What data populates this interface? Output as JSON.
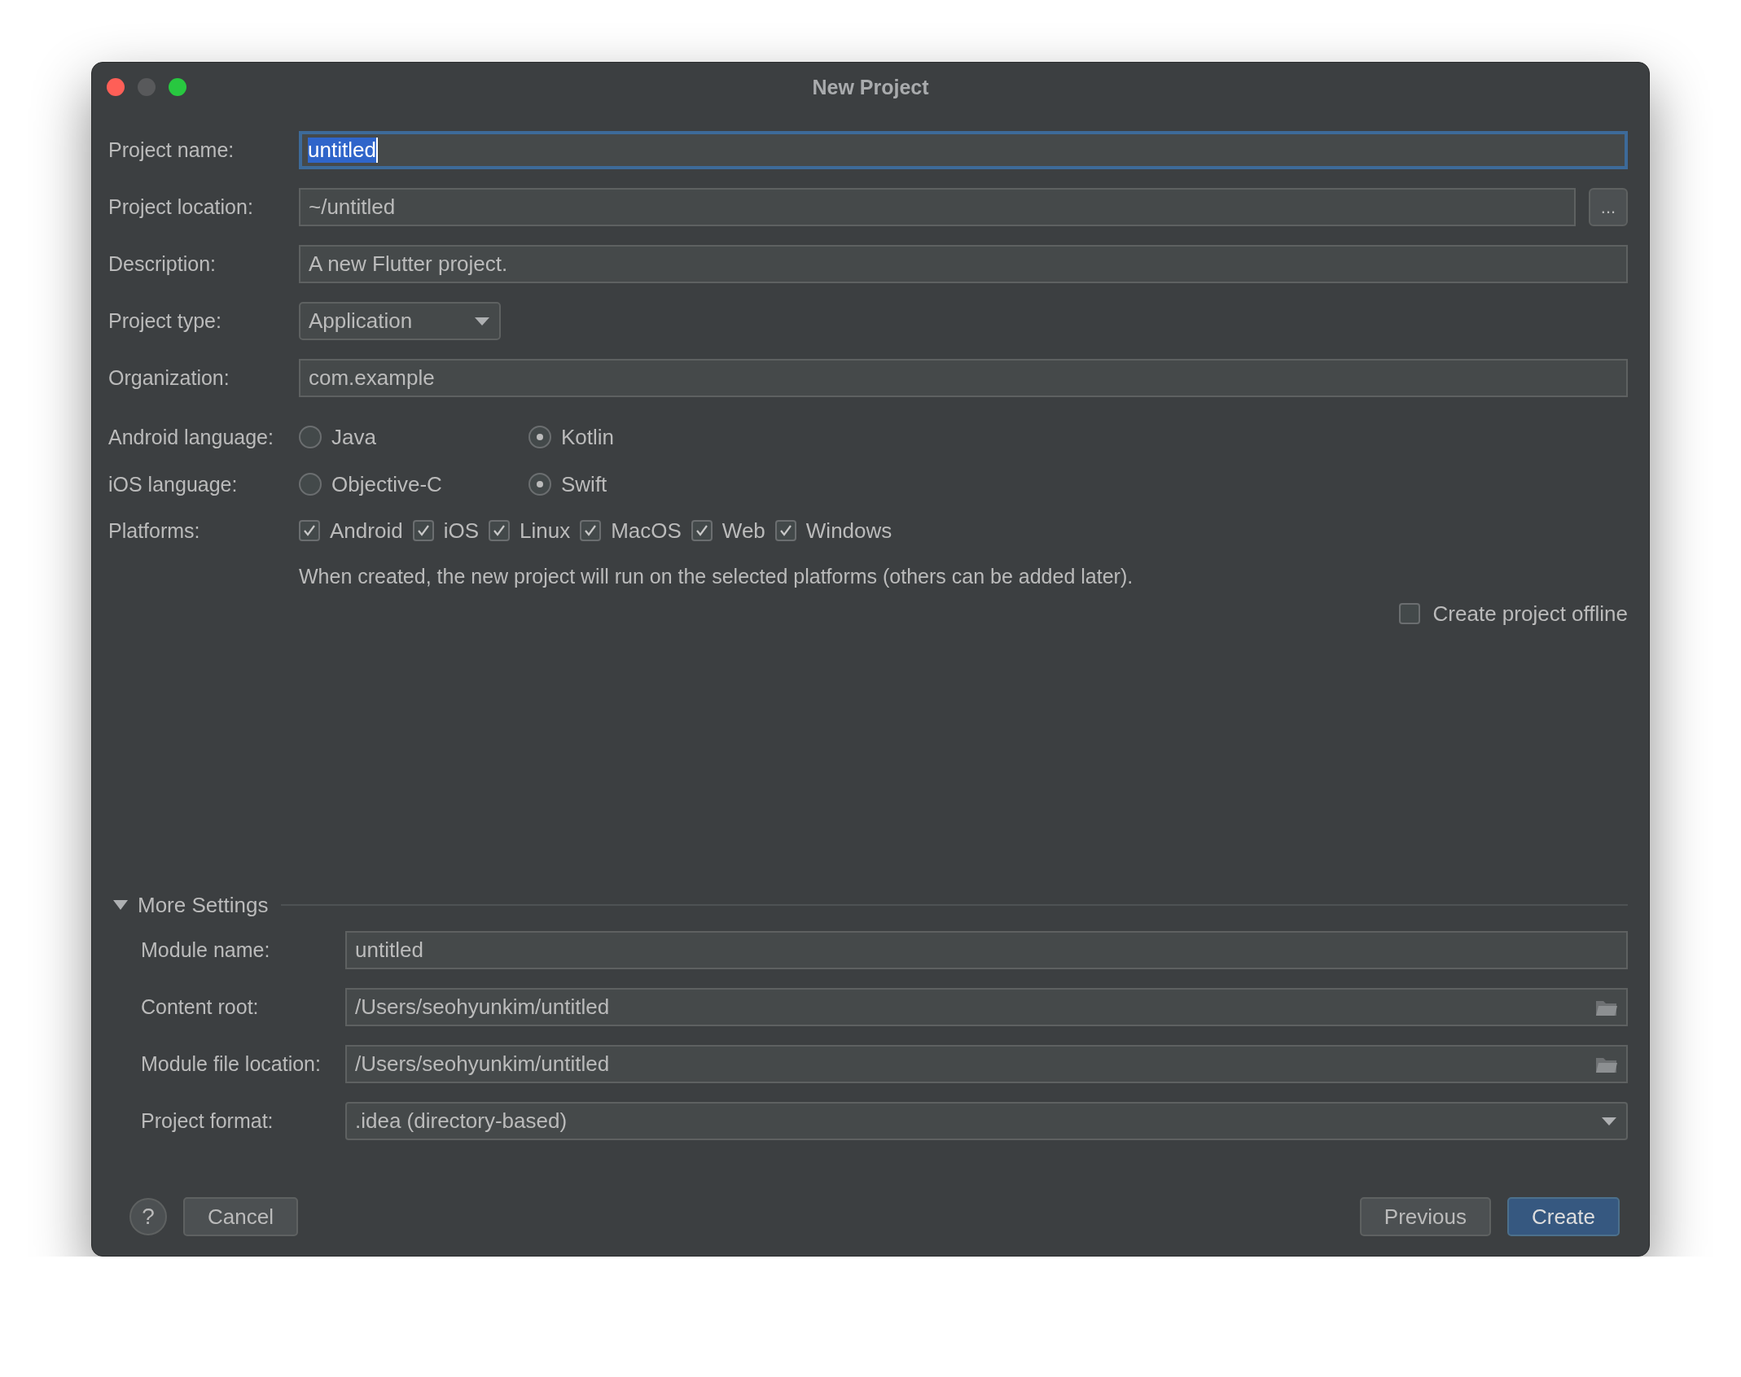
{
  "window": {
    "title": "New Project"
  },
  "fields": [
    {
      "label": "Project name:",
      "kind": "text",
      "value": "untitled",
      "focused": true
    },
    {
      "label": "Project location:",
      "kind": "browse",
      "value": "~/untitled",
      "button": "..."
    },
    {
      "label": "Description:",
      "kind": "text",
      "value": "A new Flutter project."
    },
    {
      "label": "Project type:",
      "kind": "dropdown",
      "value": "Application"
    },
    {
      "label": "Organization:",
      "kind": "text",
      "value": "com.example"
    }
  ],
  "android_language": {
    "label": "Android language:",
    "options": [
      {
        "label": "Java",
        "selected": false
      },
      {
        "label": "Kotlin",
        "selected": true
      }
    ]
  },
  "ios_language": {
    "label": "iOS language:",
    "options": [
      {
        "label": "Objective-C",
        "selected": false
      },
      {
        "label": "Swift",
        "selected": true
      }
    ]
  },
  "platforms": {
    "label": "Platforms:",
    "options": [
      {
        "label": "Android",
        "checked": true
      },
      {
        "label": "iOS",
        "checked": true
      },
      {
        "label": "Linux",
        "checked": true
      },
      {
        "label": "MacOS",
        "checked": true
      },
      {
        "label": "Web",
        "checked": true
      },
      {
        "label": "Windows",
        "checked": true
      }
    ],
    "note": "When created, the new project will run on the selected platforms (others can be added later)."
  },
  "offline": {
    "label": "Create project offline",
    "checked": false
  },
  "more_settings": {
    "title": "More Settings",
    "expanded": true,
    "fields": [
      {
        "label": "Module name:",
        "kind": "text",
        "value": "untitled"
      },
      {
        "label": "Content root:",
        "kind": "folder",
        "value": "/Users/seohyunkim/untitled"
      },
      {
        "label": "Module file location:",
        "kind": "folder",
        "value": "/Users/seohyunkim/untitled"
      },
      {
        "label": "Project format:",
        "kind": "select",
        "value": ".idea (directory-based)"
      }
    ]
  },
  "buttons": [
    {
      "label": "?",
      "kind": "help"
    },
    {
      "label": "Cancel",
      "kind": "plain"
    },
    {
      "label": "Previous",
      "kind": "plain"
    },
    {
      "label": "Create",
      "kind": "default"
    }
  ]
}
